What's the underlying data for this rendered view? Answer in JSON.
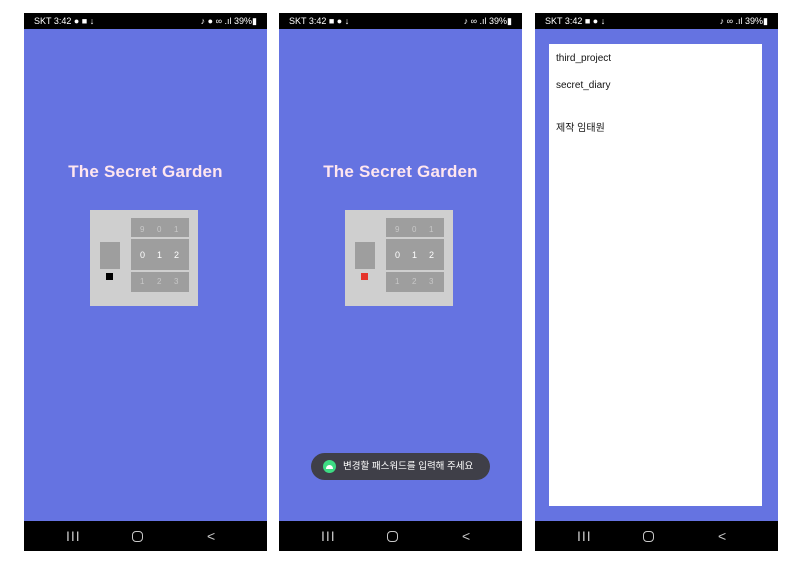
{
  "screens": [
    {
      "status_left": "SKT 3:42 ● ■ ↓",
      "status_right": "♪ ● ∞ .ıl 39%▮",
      "title": "The Secret Garden",
      "wheels": [
        [
          "9",
          "0",
          "1"
        ],
        [
          "0",
          "1",
          "2"
        ],
        [
          "1",
          "2",
          "3"
        ]
      ],
      "led_color": "#000000"
    },
    {
      "status_left": "SKT 3:42 ■ ● ↓",
      "status_right": "♪ ∞ .ıl 39%▮",
      "title": "The Secret Garden",
      "wheels": [
        [
          "9",
          "0",
          "1"
        ],
        [
          "0",
          "1",
          "2"
        ],
        [
          "1",
          "2",
          "3"
        ]
      ],
      "led_color": "#e5332a",
      "toast": "변경할 패스워드를 입력해 주세요"
    },
    {
      "status_left": "SKT 3:42 ■ ● ↓",
      "status_right": "♪ ∞ .ıl 39%▮",
      "lines": [
        "third_project",
        "secret_diary",
        "제작 임태원"
      ]
    }
  ],
  "nav": {
    "recent": "III",
    "back": "<"
  },
  "colors": {
    "background": "#6573e1",
    "title": "#ffe6ef",
    "toast": "#3f3f48"
  }
}
